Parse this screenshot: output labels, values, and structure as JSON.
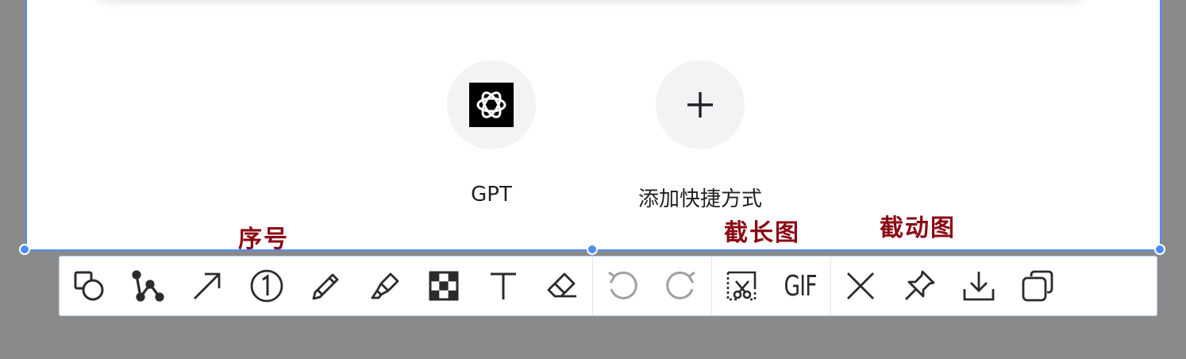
{
  "shortcuts": [
    {
      "label": "GPT",
      "icon": "openai-logo-icon"
    },
    {
      "label": "添加快捷方式",
      "icon": "plus-icon"
    }
  ],
  "annotations": {
    "serial_number": "序号",
    "long_screenshot": "截长图",
    "gif_screenshot": "截动图"
  },
  "toolbar": {
    "gif_label": "GIF",
    "tools": [
      {
        "name": "shape",
        "icon": "shape-icon"
      },
      {
        "name": "polyline",
        "icon": "polyline-icon"
      },
      {
        "name": "arrow",
        "icon": "arrow-icon"
      },
      {
        "name": "serial-number",
        "icon": "circled-one-icon"
      },
      {
        "name": "pen",
        "icon": "pencil-icon"
      },
      {
        "name": "highlighter",
        "icon": "highlighter-icon"
      },
      {
        "name": "mosaic",
        "icon": "mosaic-icon"
      },
      {
        "name": "text",
        "icon": "text-icon"
      },
      {
        "name": "eraser",
        "icon": "eraser-icon"
      },
      {
        "name": "undo",
        "icon": "undo-icon"
      },
      {
        "name": "redo",
        "icon": "redo-icon"
      },
      {
        "name": "long-screenshot",
        "icon": "scroll-capture-icon"
      },
      {
        "name": "gif",
        "icon": "gif-icon"
      },
      {
        "name": "close",
        "icon": "close-icon"
      },
      {
        "name": "pin",
        "icon": "pin-icon"
      },
      {
        "name": "save",
        "icon": "download-icon"
      },
      {
        "name": "copy",
        "icon": "copy-icon"
      }
    ]
  },
  "colors": {
    "selection_border": "#4a8ef5",
    "annotation_text": "#8b0a14",
    "overlay": "#8a8a8a"
  }
}
